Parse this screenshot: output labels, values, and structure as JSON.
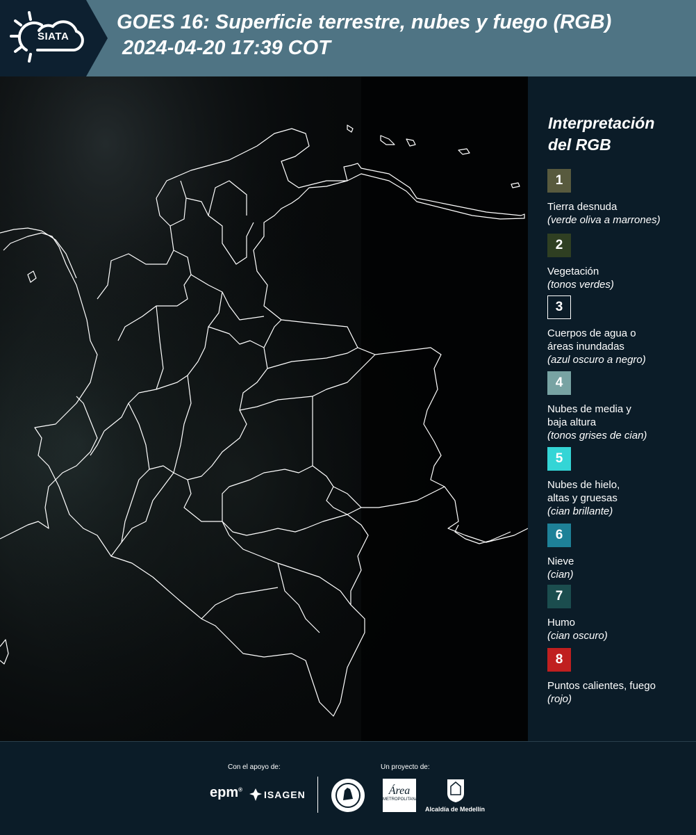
{
  "header": {
    "logo_text": "SIATA",
    "title_line1": "GOES 16: Superficie terrestre, nubes y fuego (RGB)",
    "title_line2": " 2024-04-20 17:39 COT"
  },
  "legend": {
    "title_line1": "Interpretación",
    "title_line2": "del RGB",
    "items": [
      {
        "num": "1",
        "label": "Tierra desnuda",
        "note": "(verde oliva a marrones)",
        "color": "#585a3e"
      },
      {
        "num": "2",
        "label": "Vegetación",
        "note": "(tonos verdes)",
        "color": "#2f3f22"
      },
      {
        "num": "3",
        "label_line1": "Cuerpos de agua o",
        "label_line2": "áreas inundadas",
        "note": "(azul oscuro a negro)",
        "color": "#0b1c28"
      },
      {
        "num": "4",
        "label_line1": "Nubes de media y",
        "label_line2": "baja altura",
        "note": "(tonos grises de cian)",
        "color": "#78a3a3"
      },
      {
        "num": "5",
        "label_line1": "Nubes de hielo,",
        "label_line2": "altas y gruesas",
        "note": "(cian brillante)",
        "color": "#34d5d6"
      },
      {
        "num": "6",
        "label": "Nieve",
        "note": "(cian)",
        "color": "#1e8198"
      },
      {
        "num": "7",
        "label": "Humo",
        "note": "(cian oscuro)",
        "color": "#1b4d4e"
      },
      {
        "num": "8",
        "label": "Puntos calientes, fuego",
        "note": "(rojo)",
        "color": "#c01f1f"
      }
    ]
  },
  "footer": {
    "support_label": "Con el apoyo de:",
    "project_label": "Un proyecto de:",
    "sponsor_epm": "epm",
    "sponsor_isagen": "ISAGEN",
    "partner_area_name": "Área",
    "partner_area_sub": "METROPOLITANA",
    "partner_alcaldia": "Alcaldía de Medellín"
  }
}
